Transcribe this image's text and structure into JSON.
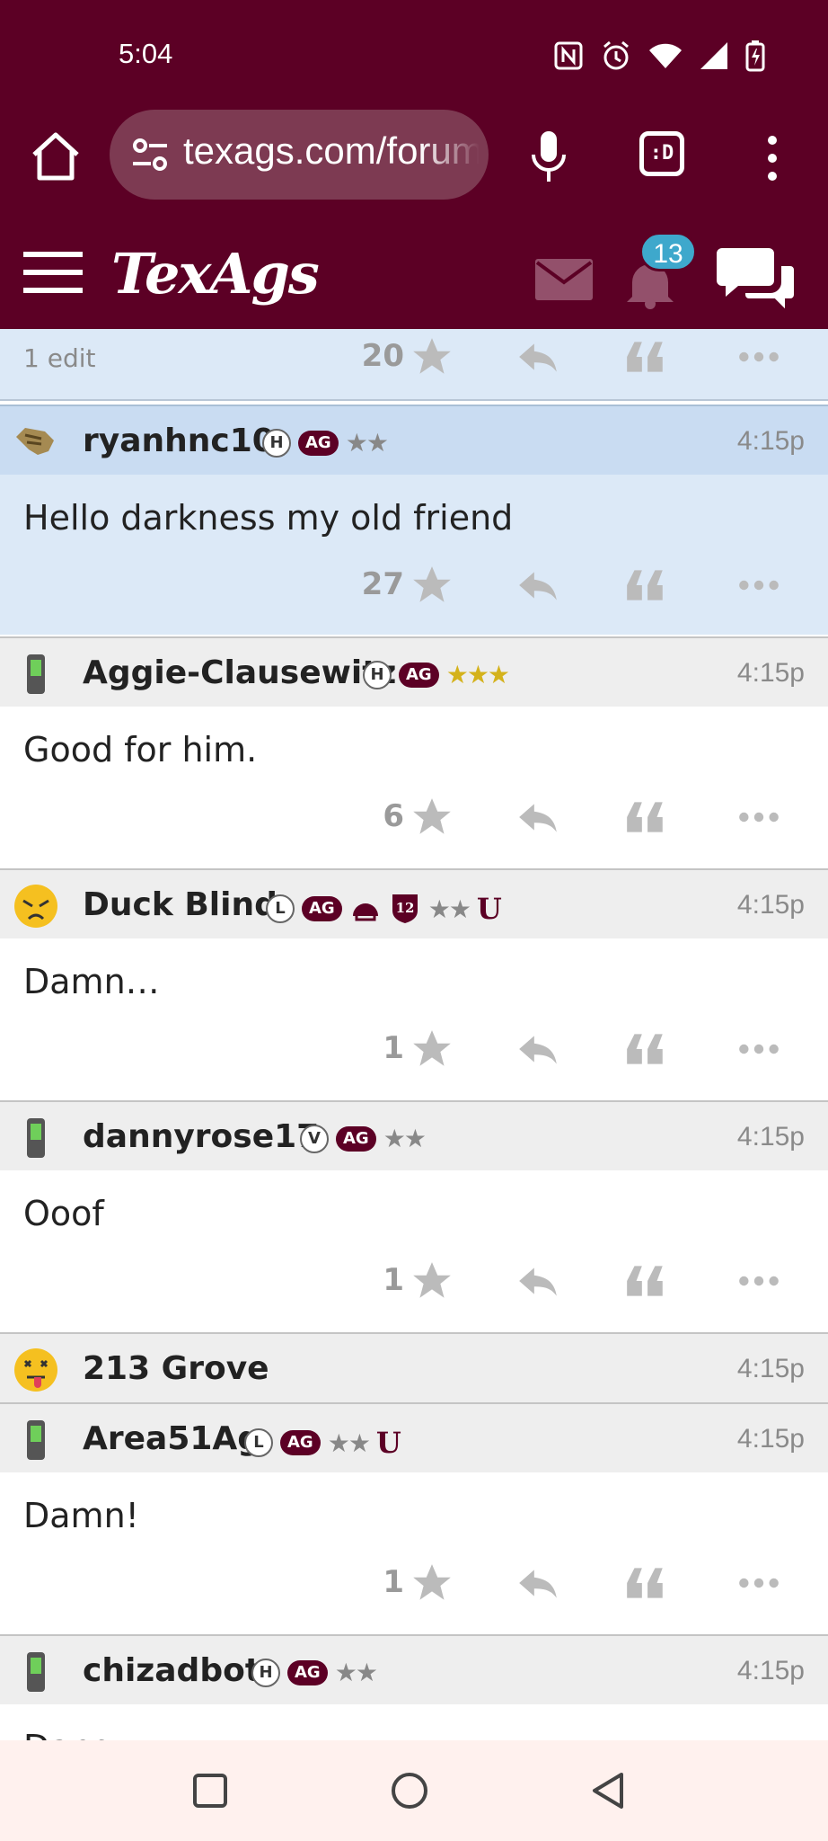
{
  "status": {
    "time": "5:04"
  },
  "browser": {
    "url": "texags.com/forums",
    "tabs_label": ":D"
  },
  "site": {
    "logo": "TexAgs",
    "notification_count": "13"
  },
  "prev_post": {
    "edit_label": "1 edit",
    "likes": "20"
  },
  "posts": [
    {
      "username": "ryanhnc10",
      "badges": [
        "H",
        "AG"
      ],
      "stars": "★★",
      "time": "4:15p",
      "text": "Hello darkness my old friend",
      "likes": "27"
    },
    {
      "username": "Aggie-Clausewitz",
      "badges": [
        "H",
        "AG"
      ],
      "stars": "★★★",
      "time": "4:15p",
      "text": "Good for him.",
      "likes": "6"
    },
    {
      "username": "Duck Blind",
      "badges": [
        "L",
        "AG"
      ],
      "badge_12": "12",
      "stars": "★★",
      "u": "U",
      "time": "4:15p",
      "text": "Damn…",
      "likes": "1"
    },
    {
      "username": "dannyrose17",
      "badges": [
        "V",
        "AG"
      ],
      "stars": "★★",
      "time": "4:15p",
      "text": "Ooof",
      "likes": "1"
    },
    {
      "username": "213 Grove",
      "time": "4:15p"
    },
    {
      "username": "Area51Ag",
      "badges": [
        "L",
        "AG"
      ],
      "stars": "★★",
      "u": "U",
      "time": "4:15p",
      "text": "Damn!",
      "likes": "1"
    },
    {
      "username": "chizadbot",
      "badges": [
        "H",
        "AG"
      ],
      "stars": "★★",
      "time": "4:15p",
      "text": "Dang"
    }
  ]
}
